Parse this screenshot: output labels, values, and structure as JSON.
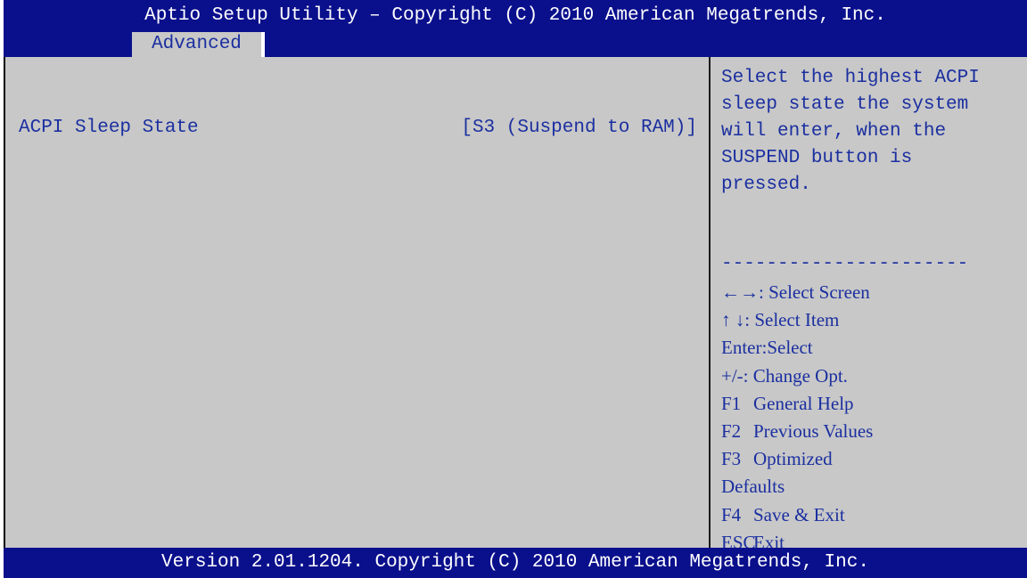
{
  "header": {
    "title": "Aptio Setup Utility – Copyright (C) 2010 American Megatrends, Inc."
  },
  "tabs": {
    "active": "Advanced"
  },
  "settings": [
    {
      "label": "ACPI Sleep State",
      "value": "[S3 (Suspend to RAM)]"
    }
  ],
  "help": {
    "lines": [
      "Select the highest ACPI",
      "sleep state the system",
      "will enter, when the",
      "SUSPEND button is",
      "pressed."
    ],
    "separator": "----------------------"
  },
  "keys": [
    {
      "key": "←→",
      "desc": ": Select Screen"
    },
    {
      "key": "↑ ↓",
      "desc": ": Select Item"
    },
    {
      "key": "Enter",
      "desc": ":Select"
    },
    {
      "key": "+/-",
      "desc": ": Change Opt."
    },
    {
      "key": "F1",
      "desc": "General Help"
    },
    {
      "key": "F2",
      "desc": "Previous Values"
    },
    {
      "key": "F3",
      "desc": "Optimized"
    },
    {
      "key": "",
      "desc": "Defaults"
    },
    {
      "key": "F4",
      "desc": "Save & Exit"
    },
    {
      "key": "ESC",
      "desc": "Exit"
    }
  ],
  "footer": {
    "version": "Version 2.01.1204. Copyright (C) 2010 American Megatrends, Inc."
  },
  "colors": {
    "bar_blue": "#0a0f8c",
    "panel_gray": "#c8c8c8",
    "text_blue": "#1b2fa0",
    "text_white": "#ffffff"
  }
}
